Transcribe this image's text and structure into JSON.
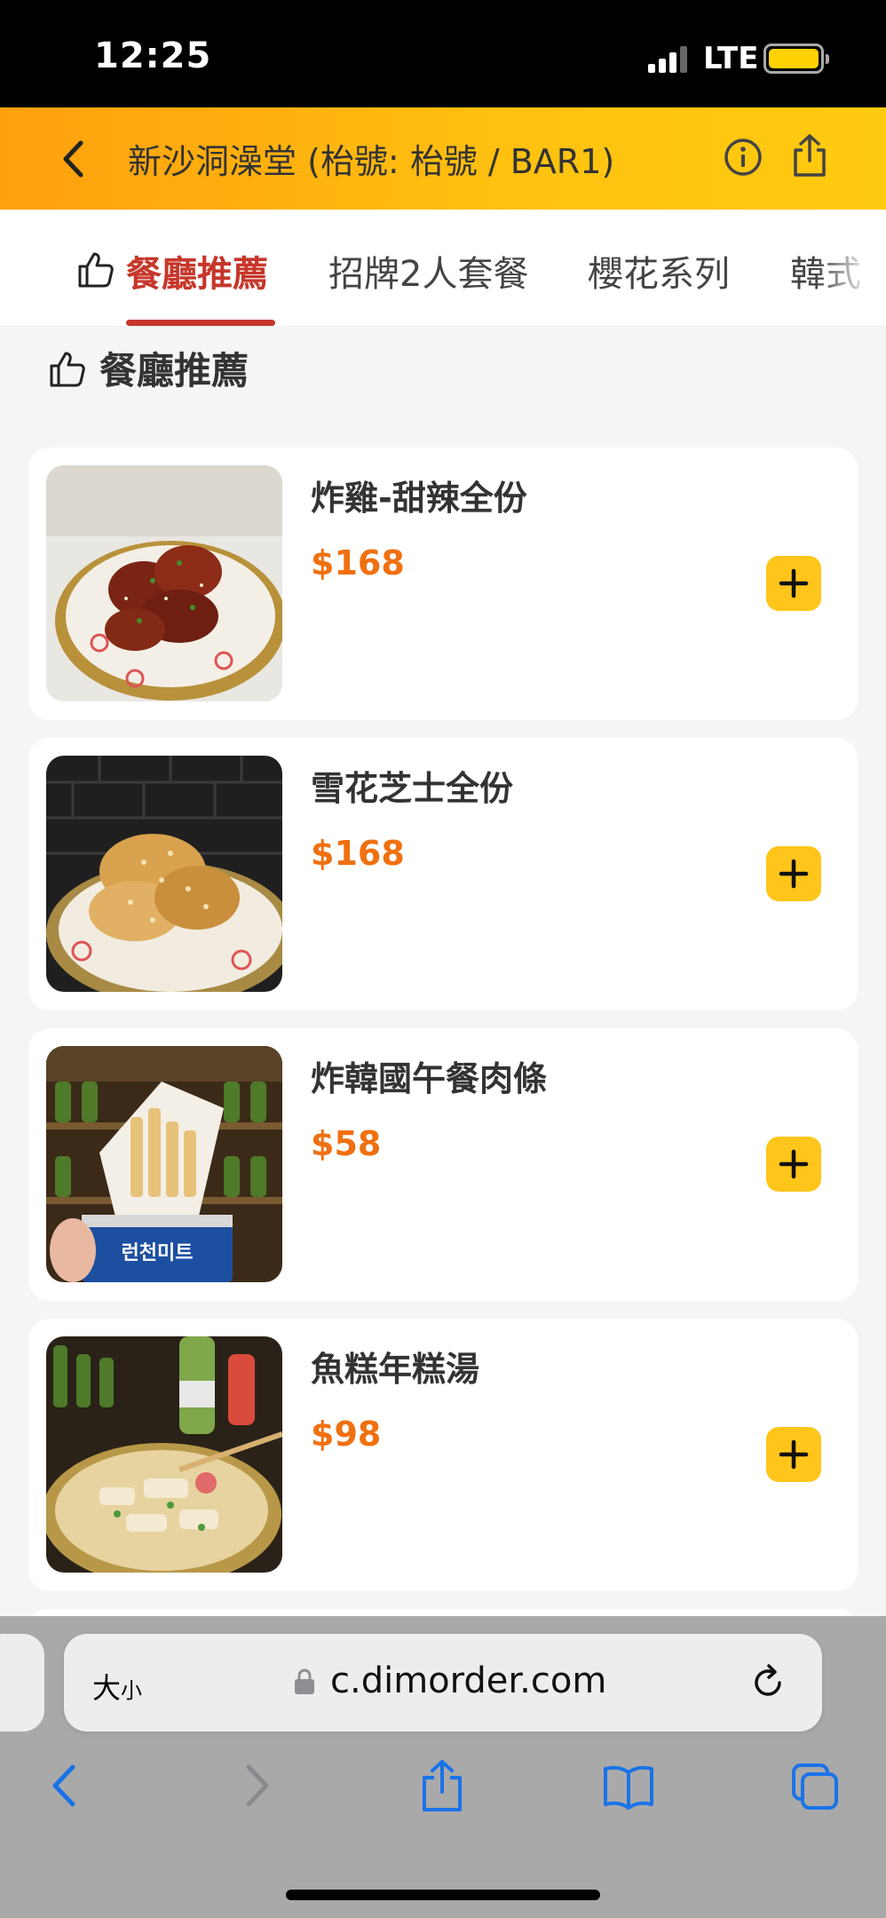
{
  "status_bar": {
    "time": "12:25",
    "network": "LTE"
  },
  "header": {
    "title": "新沙洞澡堂 (枱號: 枱號 / BAR1)"
  },
  "tabs": [
    {
      "label": "餐廳推薦",
      "active": true
    },
    {
      "label": "招牌2人套餐",
      "active": false
    },
    {
      "label": "櫻花系列",
      "active": false
    },
    {
      "label": "韓式",
      "active": false
    }
  ],
  "section": {
    "title": "餐廳推薦"
  },
  "items": [
    {
      "name": "炸雞-甜辣全份",
      "price": "$168"
    },
    {
      "name": "雪花芝士全份",
      "price": "$168"
    },
    {
      "name": "炸韓國午餐肉條",
      "price": "$58"
    },
    {
      "name": "魚糕年糕湯",
      "price": "$98"
    }
  ],
  "browser": {
    "size_label_big": "大",
    "size_label_small": "小",
    "url": "c.dimorder.com"
  },
  "colors": {
    "accent": "#c6372b",
    "price": "#f07010",
    "header": "#ffc210",
    "add_button": "#ffc51a"
  },
  "image_badge": "런천미트"
}
